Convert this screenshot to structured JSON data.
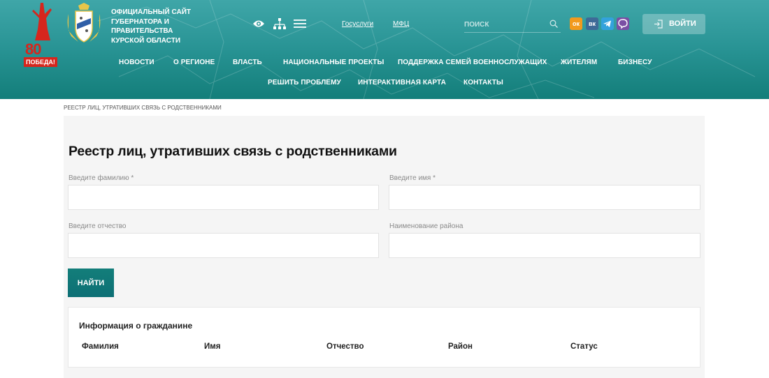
{
  "header": {
    "victory_number": "80",
    "victory_word": "ПОБЕДА!",
    "site_title": "Официальный сайт Губернатора и Правительства Курской области",
    "links": {
      "gosuslugi": "Госуслуги",
      "mfc": "МФЦ"
    },
    "search": {
      "placeholder": "ПОИСК"
    },
    "social": {
      "ok": "ок",
      "vk": "вк"
    },
    "login_label": "ВОЙТИ",
    "nav_row1": [
      "Новости",
      "О регионе",
      "Власть",
      "Национальные проекты",
      "Поддержка семей военнослужащих",
      "Жителям",
      "Бизнесу"
    ],
    "nav_row2": [
      "Решить проблему",
      "Интерактивная карта",
      "Контакты"
    ]
  },
  "breadcrumb": "РЕЕСТР ЛИЦ, УТРАТИВШИХ СВЯЗЬ С РОДСТВЕННИКАМИ",
  "form": {
    "title": "Реестр лиц, утративших связь с родственниками",
    "fields": {
      "surname": {
        "label": "Введите фамилию *",
        "value": ""
      },
      "name": {
        "label": "Введите имя *",
        "value": ""
      },
      "patronymic": {
        "label": "Введите отчество",
        "value": ""
      },
      "district": {
        "label": "Наименование района",
        "value": ""
      }
    },
    "submit_label": "НАЙТИ"
  },
  "results": {
    "title": "Информация о гражданине",
    "columns": [
      "Фамилия",
      "Имя",
      "Отчество",
      "Район",
      "Статус"
    ]
  },
  "colors": {
    "header_teal": "#2a9596",
    "header_dark": "#137e7a",
    "victory_red": "#d6261d",
    "panel_bg": "#f5f5f5",
    "button": "#137e7a"
  }
}
